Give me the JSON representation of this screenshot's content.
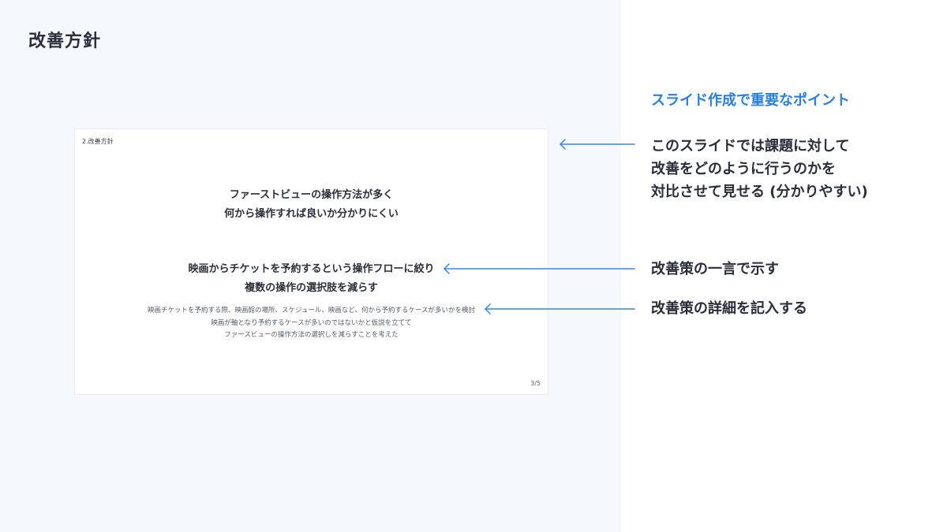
{
  "page_title": "改善方針",
  "slide": {
    "header": "2.改善方針",
    "problem_lines": [
      "ファーストビューの操作方法が多く",
      "何から操作すれば良いか分かりにくい"
    ],
    "solution_lines": [
      "映画からチケットを予約するという操作フローに絞り",
      "複数の操作の選択肢を減らす"
    ],
    "detail_lines": [
      "映画チケットを予約する際、映画館の場所、スケジュール、映画など、何から予約するケースが多いかを検討",
      "映画が軸となり予約するケースが多いのではないかと仮説を立てて",
      "ファースビューの操作方法の選択しを減らすことを考えた"
    ],
    "page_number": "3/5"
  },
  "notes": {
    "heading": "スライド作成で重要なポイント",
    "heading_color": "#2b7fe0",
    "arrow_color": "#3b86e0",
    "note1_lines": [
      "このスライドでは課題に対して",
      "改善をどのように行うのかを",
      "対比させて見せる (分かりやすい)"
    ],
    "note2": "改善策の一言で示す",
    "note3": "改善策の詳細を記入する"
  }
}
